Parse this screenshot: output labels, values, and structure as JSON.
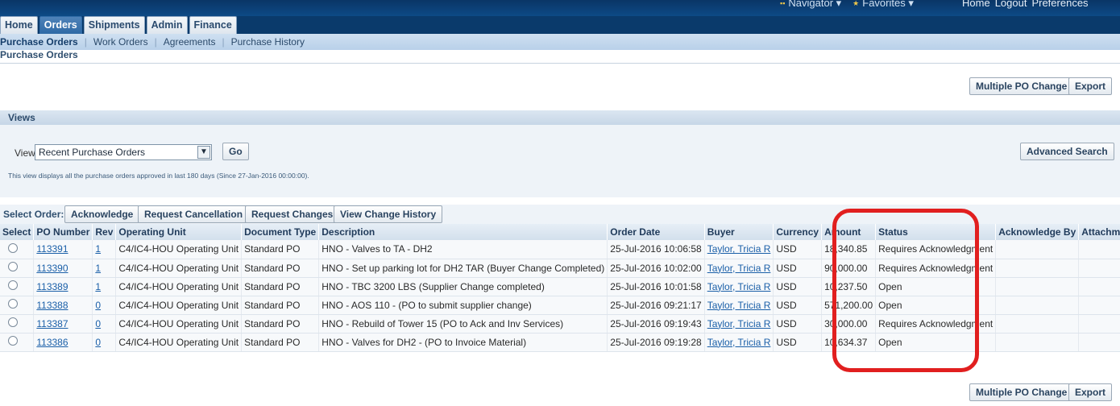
{
  "header": {
    "nav_links": [
      {
        "icon": "navigator-icon",
        "label": "Navigator ▾"
      },
      {
        "icon": "favorites-icon",
        "label": "Favorites ▾"
      }
    ],
    "global_links": [
      "Home",
      "Logout",
      "Preferences"
    ]
  },
  "tabs": [
    "Home",
    "Orders",
    "Shipments",
    "Admin",
    "Finance"
  ],
  "active_tab": "Orders",
  "subnav": [
    "Purchase Orders",
    "Work Orders",
    "Agreements",
    "Purchase History"
  ],
  "breadcrumb": "Purchase Orders",
  "top_buttons": {
    "multiple_po_change": "Multiple PO Change",
    "export": "Export"
  },
  "views": {
    "header": "Views",
    "label": "View",
    "selected": "Recent Purchase Orders",
    "go": "Go",
    "advanced_search": "Advanced Search",
    "note": "This view displays all the purchase orders approved in last 180 days (Since 27-Jan-2016 00:00:00)."
  },
  "select_order": {
    "label": "Select Order:",
    "buttons": [
      "Acknowledge",
      "Request Cancellation",
      "Request Changes",
      "View Change History"
    ]
  },
  "table": {
    "columns": [
      "Select",
      "PO Number",
      "Rev",
      "Operating Unit",
      "Document Type",
      "Description",
      "Order Date",
      "Buyer",
      "Currency",
      "Amount",
      "Status",
      "Acknowledge By",
      "Attachments"
    ],
    "rows": [
      {
        "po": "113391",
        "rev": "1",
        "unit": "C4/IC4-HOU Operating Unit",
        "doctype": "Standard PO",
        "desc": "HNO - Valves to TA - DH2",
        "date": "25-Jul-2016 10:06:58",
        "buyer": "Taylor, Tricia R",
        "currency": "USD",
        "amount": "18,340.85",
        "status": "Requires Acknowledgment",
        "ack_by": "",
        "attach": ""
      },
      {
        "po": "113390",
        "rev": "1",
        "unit": "C4/IC4-HOU Operating Unit",
        "doctype": "Standard PO",
        "desc": "HNO - Set up parking lot for DH2 TAR (Buyer Change Completed)",
        "date": "25-Jul-2016 10:02:00",
        "buyer": "Taylor, Tricia R",
        "currency": "USD",
        "amount": "90,000.00",
        "status": "Requires Acknowledgment",
        "ack_by": "",
        "attach": ""
      },
      {
        "po": "113389",
        "rev": "1",
        "unit": "C4/IC4-HOU Operating Unit",
        "doctype": "Standard PO",
        "desc": "HNO - TBC 3200 LBS (Supplier Change completed)",
        "date": "25-Jul-2016 10:01:58",
        "buyer": "Taylor, Tricia R",
        "currency": "USD",
        "amount": "10,237.50",
        "status": "Open",
        "ack_by": "",
        "attach": ""
      },
      {
        "po": "113388",
        "rev": "0",
        "unit": "C4/IC4-HOU Operating Unit",
        "doctype": "Standard PO",
        "desc": "HNO - AOS 110 - (PO to submit supplier change)",
        "date": "25-Jul-2016 09:21:17",
        "buyer": "Taylor, Tricia R",
        "currency": "USD",
        "amount": "571,200.00",
        "status": "Open",
        "ack_by": "",
        "attach": ""
      },
      {
        "po": "113387",
        "rev": "0",
        "unit": "C4/IC4-HOU Operating Unit",
        "doctype": "Standard PO",
        "desc": "HNO - Rebuild of Tower 15 (PO to Ack and Inv Services)",
        "date": "25-Jul-2016 09:19:43",
        "buyer": "Taylor, Tricia R",
        "currency": "USD",
        "amount": "30,000.00",
        "status": "Requires Acknowledgment",
        "ack_by": "",
        "attach": ""
      },
      {
        "po": "113386",
        "rev": "0",
        "unit": "C4/IC4-HOU Operating Unit",
        "doctype": "Standard PO",
        "desc": "HNO - Valves for DH2 - (PO to Invoice Material)",
        "date": "25-Jul-2016 09:19:28",
        "buyer": "Taylor, Tricia R",
        "currency": "USD",
        "amount": "10,634.37",
        "status": "Open",
        "ack_by": "",
        "attach": ""
      }
    ]
  },
  "bottom_buttons": {
    "multiple_po_change": "Multiple PO Change",
    "export": "Export"
  },
  "colors": {
    "annotation": "#e11f1f",
    "link": "#1a5fa8",
    "active_tab": "#2f6aa6"
  }
}
